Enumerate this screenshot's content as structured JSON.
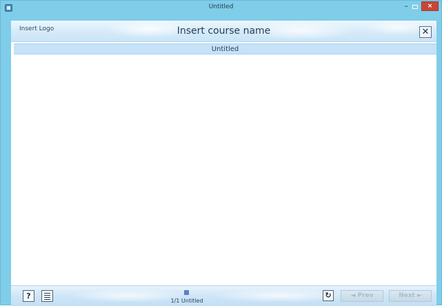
{
  "window": {
    "title": "Untitled",
    "minimize_glyph": "–",
    "close_glyph": "×"
  },
  "header": {
    "logo_text": "Insert Logo",
    "course_name": "Insert course name",
    "close_glyph": "✕"
  },
  "subtitle": "Untitled",
  "footer": {
    "help_glyph": "?",
    "page_indicator": "1/1 Untitled",
    "reload_glyph": "↻",
    "prev_label": "◄ Prev",
    "next_label": "Next ►"
  },
  "colors": {
    "window_frame": "#7fcde8",
    "accent_close": "#c7463a",
    "page_marker": "#5b7fd1"
  },
  "icons": {
    "app": "app-icon",
    "help": "question-icon",
    "menu": "menu-icon",
    "reload": "reload-icon"
  }
}
